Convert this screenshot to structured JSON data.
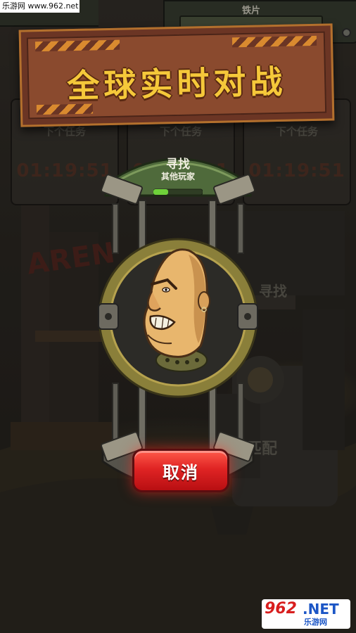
{
  "watermark": {
    "top_text": "乐游网 www.962.net",
    "bottom_num": "962",
    "bottom_net": ".NET",
    "bottom_sub": "乐游网"
  },
  "hud": {
    "resource_label": "铁片"
  },
  "banner": {
    "title": "全球实时对战"
  },
  "task_cards": [
    {
      "title": "下个任务",
      "time": "01:19:51"
    },
    {
      "title": "下个任务",
      "time": "01:19:51"
    },
    {
      "title": "下个任务",
      "time": "01:19:51"
    }
  ],
  "background": {
    "arena_sign": "AREN",
    "search_ghost": "寻找",
    "match_ghost": "匹配"
  },
  "matchmaking": {
    "title": "寻找",
    "subtitle": "其他玩家",
    "progress": 0.3
  },
  "cancel_button": {
    "label": "取消"
  },
  "colors": {
    "banner_title": "#f5c83a",
    "banner_bg": "#8a4a2e",
    "cancel_red": "#e02424",
    "progress_green": "#6fd23a"
  }
}
